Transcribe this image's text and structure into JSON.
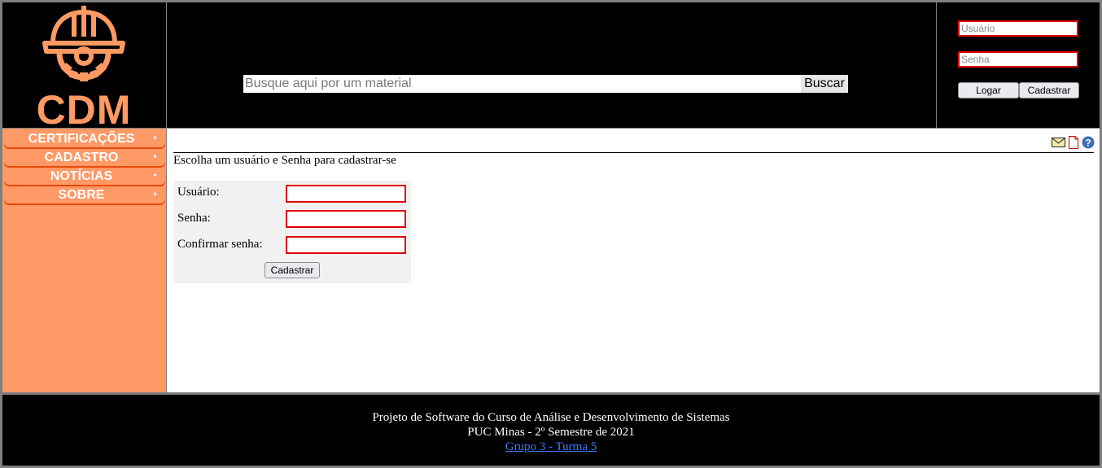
{
  "brand": {
    "logo_text": "CDM",
    "accent_color": "#ff9966",
    "logo_color": "#ff9a62"
  },
  "search": {
    "placeholder": "Busque aqui por um material",
    "value": "",
    "button_label": "Buscar"
  },
  "login": {
    "username_placeholder": "Usuário",
    "password_placeholder": "Senha",
    "login_button": "Logar",
    "register_button": "Cadastrar"
  },
  "sidebar": {
    "items": [
      {
        "label": "CERTIFICAÇÕES"
      },
      {
        "label": "CADASTRO"
      },
      {
        "label": "NOTÍCIAS"
      },
      {
        "label": "SOBRE"
      }
    ]
  },
  "toolbar_icons": [
    "mail-icon",
    "pdf-icon",
    "help-icon"
  ],
  "content": {
    "intro": "Escolha um usuário e Senha para cadastrar-se",
    "form": {
      "username_label": "Usuário:",
      "password_label": "Senha:",
      "confirm_label": "Confirmar senha:",
      "submit_label": "Cadastrar"
    }
  },
  "footer": {
    "line1": "Projeto de Software do Curso de Análise e Desenvolvimento de Sistemas",
    "line2": "PUC Minas - 2º Semestre de 2021",
    "link": "Grupo 3 - Turma 5"
  }
}
